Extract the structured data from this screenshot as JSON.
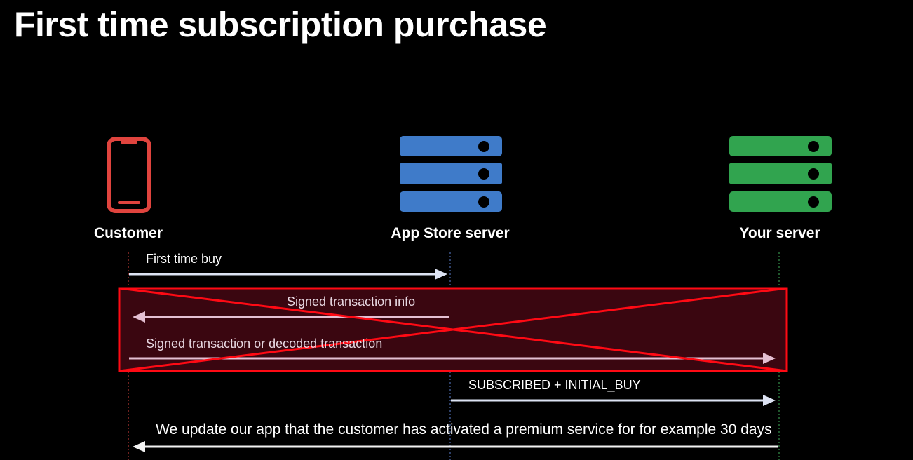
{
  "title": "First time subscription purchase",
  "actors": [
    {
      "name": "Customer",
      "icon": "phone-icon",
      "color": "#e0443e"
    },
    {
      "name": "App Store server",
      "icon": "server-icon",
      "color": "#3f7bc9"
    },
    {
      "name": "Your server",
      "icon": "server-icon",
      "color": "#31a44f"
    }
  ],
  "messages": [
    {
      "label": "First time buy",
      "from": "Customer",
      "to": "App Store server"
    },
    {
      "label": "Signed transaction info",
      "from": "App Store server",
      "to": "Customer",
      "crossed_out": true
    },
    {
      "label": "Signed transaction or decoded transaction",
      "from": "Customer",
      "to": "Your server",
      "crossed_out": true
    },
    {
      "label": "SUBSCRIBED + INITIAL_BUY",
      "from": "App Store server",
      "to": "Your server"
    },
    {
      "label": "We update our app that the customer has activated a premium service for for example 30 days",
      "from": "Your server",
      "to": "Customer"
    }
  ],
  "colors": {
    "arrow": "#dde3f3",
    "arrow_crossed": "#e4bfd2",
    "cross_out": "#ff0a14",
    "cross_fill": "#3a0610"
  }
}
